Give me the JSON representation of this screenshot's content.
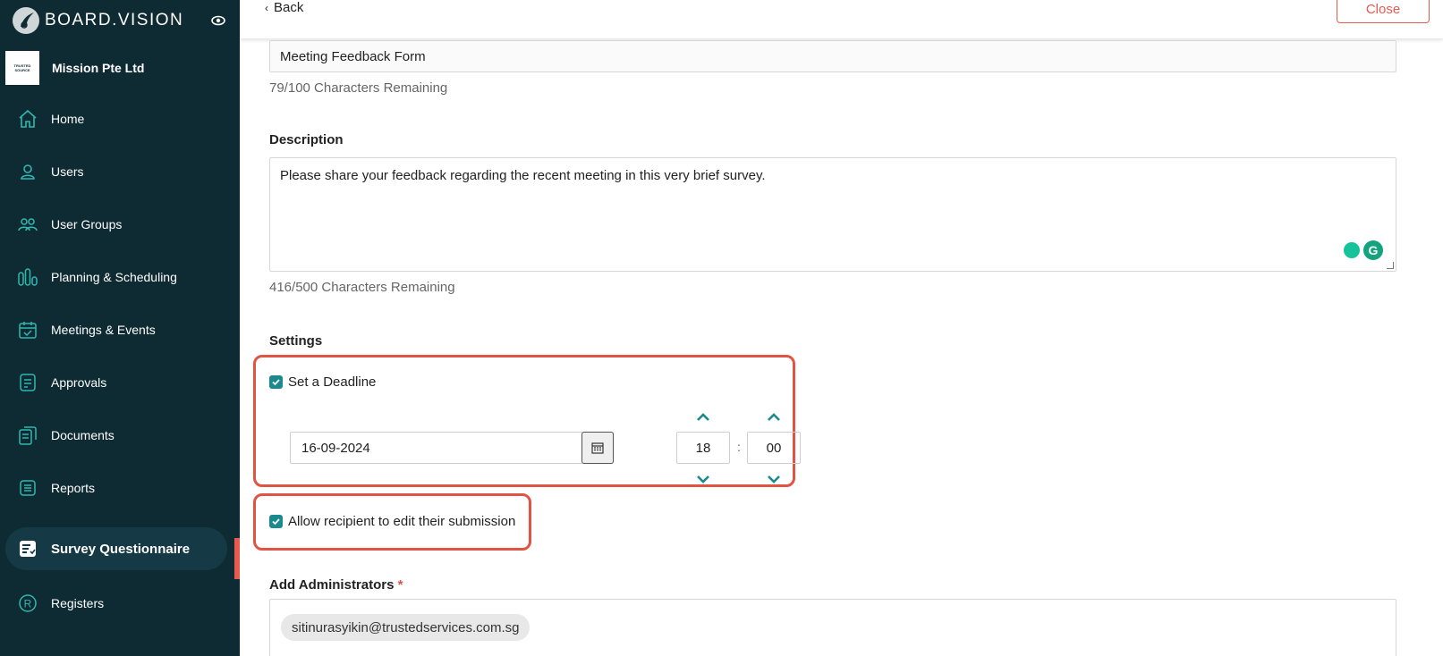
{
  "sidebar": {
    "brand": "BOARD.VISION",
    "org_badge_line1": "TRUSTED",
    "org_badge_line2": "SOURCE",
    "org_name": "Mission Pte Ltd",
    "items": [
      {
        "label": "Home",
        "icon": "home-icon"
      },
      {
        "label": "Users",
        "icon": "user-icon"
      },
      {
        "label": "User Groups",
        "icon": "user-group-icon"
      },
      {
        "label": "Planning & Scheduling",
        "icon": "planning-icon"
      },
      {
        "label": "Meetings & Events",
        "icon": "calendar-check-icon"
      },
      {
        "label": "Approvals",
        "icon": "approvals-icon"
      },
      {
        "label": "Documents",
        "icon": "documents-icon"
      },
      {
        "label": "Reports",
        "icon": "reports-icon"
      },
      {
        "label": "Survey Questionnaire",
        "icon": "survey-icon",
        "active": true
      },
      {
        "label": "Registers",
        "icon": "registers-icon"
      }
    ]
  },
  "header": {
    "back_label": "Back",
    "close_label": "Close"
  },
  "form": {
    "title_value": "Meeting Feedback Form",
    "title_counter": "79/100 Characters Remaining",
    "description_label": "Description",
    "description_value": "Please share your feedback regarding the recent meeting in this very brief survey.",
    "description_counter": "416/500 Characters Remaining",
    "settings_label": "Settings",
    "deadline_label": "Set a Deadline",
    "deadline_checked": true,
    "deadline_date": "16-09-2024",
    "deadline_hour": "18",
    "deadline_minute": "00",
    "time_separator": ":",
    "allow_edit_label": "Allow recipient to edit their submission",
    "allow_edit_checked": true,
    "admins_label": "Add Administrators",
    "admins_required_mark": "*",
    "admins": [
      "sitinurasyikin@trustedservices.com.sg"
    ]
  },
  "colors": {
    "sidebar_bg": "#0e2a33",
    "accent_teal": "#1a8a8f",
    "highlight_red": "#e05443",
    "close_red": "#e85a4f"
  }
}
